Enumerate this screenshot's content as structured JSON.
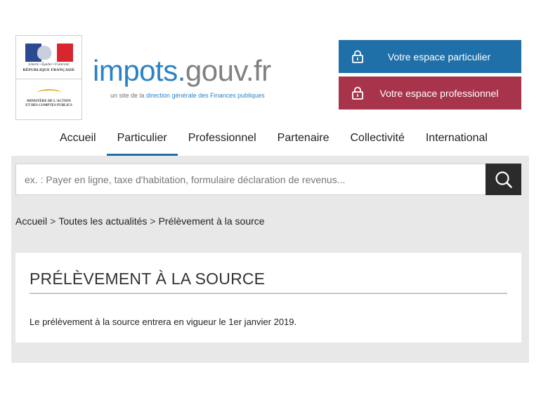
{
  "logo": {
    "motto": "Liberté • Égalité • Fraternité",
    "republic": "RÉPUBLIQUE FRANÇAISE",
    "ministry_line1": "MINISTÈRE DE L'ACTION",
    "ministry_line2": "ET DES COMPTES PUBLICS"
  },
  "site": {
    "name_part1": "impots.",
    "name_part2": "gouv.fr",
    "tagline_prefix": "un site de la ",
    "tagline_accent": "direction générale des Finances publiques"
  },
  "accounts": {
    "particulier_label": "Votre espace particulier",
    "professionnel_label": "Votre espace professionnel",
    "colors": {
      "particulier": "#1f6fa8",
      "professionnel": "#a8344b"
    },
    "icon": "lock-icon"
  },
  "nav": {
    "items": [
      "Accueil",
      "Particulier",
      "Professionnel",
      "Partenaire",
      "Collectivité",
      "International"
    ],
    "active": "Particulier"
  },
  "search": {
    "placeholder": "ex. : Payer en ligne, taxe d'habitation, formulaire déclaration de revenus...",
    "value": "",
    "button_icon": "search-icon"
  },
  "breadcrumb": {
    "items": [
      "Accueil",
      "Toutes les actualités",
      "Prélèvement à la source"
    ],
    "separator": ">"
  },
  "article": {
    "title": "PRÉLÈVEMENT À LA SOURCE",
    "body": "Le prélèvement à la source entrera en vigueur le 1er janvier 2019."
  }
}
